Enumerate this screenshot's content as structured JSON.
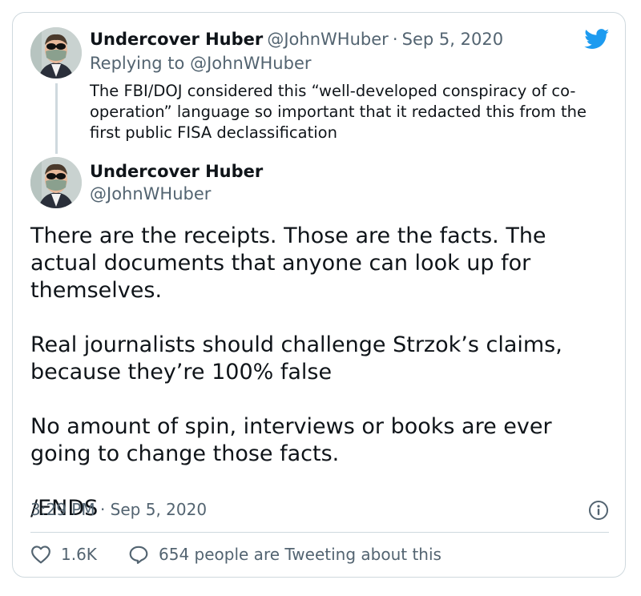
{
  "quoted_tweet": {
    "author_name": "Undercover Huber",
    "handle": "@JohnWHuber",
    "separator": "·",
    "date": "Sep 5, 2020",
    "replying_prefix": "Replying to",
    "replying_handle": "@JohnWHuber",
    "text": "The FBI/DOJ considered this “well-developed conspiracy of co-operation” language so important that it redacted this from the first public FISA declassification"
  },
  "main_tweet": {
    "author_name": "Undercover Huber",
    "handle": "@JohnWHuber",
    "paragraphs": [
      "There are the receipts. Those are the facts. The actual documents that anyone can look up for themselves.",
      "Real journalists should challenge Strzok’s claims, because they’re 100% false",
      "No amount of spin, interviews or books are ever going to change those facts.",
      "/ENDS"
    ],
    "time": "3:29 PM",
    "separator": "·",
    "date": "Sep 5, 2020"
  },
  "actions": {
    "likes": "1.6K",
    "conversation": "654 people are Tweeting about this"
  },
  "icons": {
    "brand": "twitter-bird-icon",
    "info": "info-icon",
    "like": "heart-icon",
    "reply": "speech-bubble-icon"
  },
  "colors": {
    "brand_blue": "#1d9bf0",
    "text": "#0f1419",
    "secondary": "#536471",
    "border": "#cfd9de"
  }
}
